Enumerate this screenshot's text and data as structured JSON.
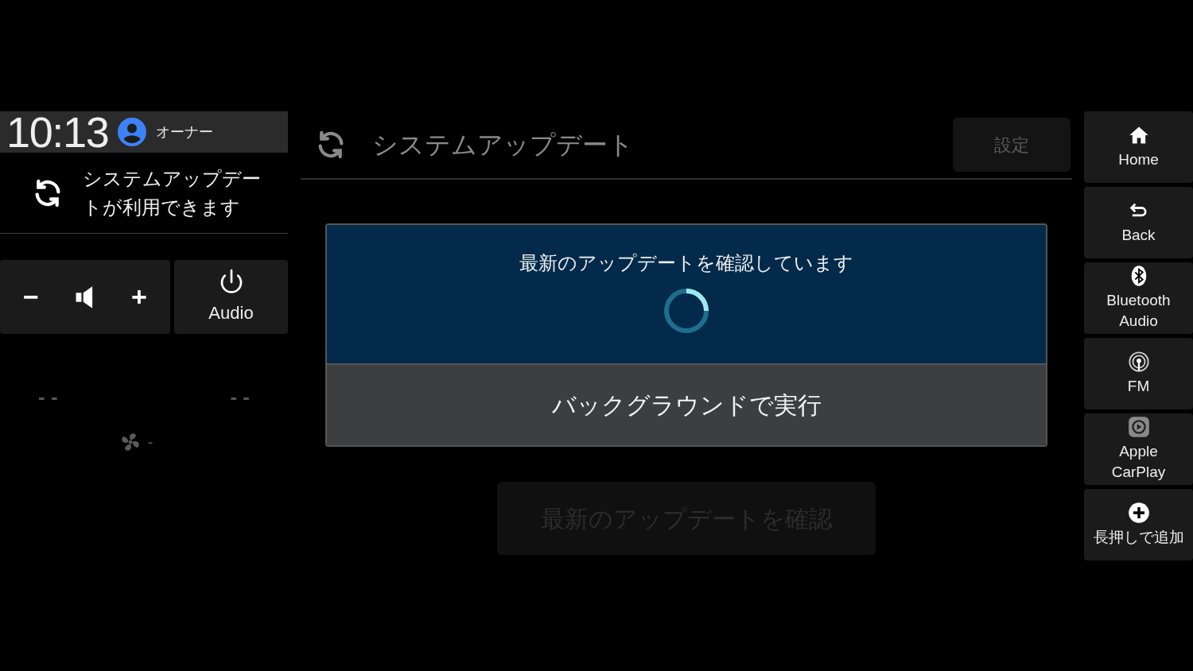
{
  "status": {
    "time": "10:13",
    "user": "オーナー"
  },
  "notification": {
    "text": "システムアップデートが利用できます"
  },
  "volume": {
    "minus": "−",
    "plus": "+"
  },
  "audio_button": {
    "label": "Audio"
  },
  "climate": {
    "left_temp": "- -",
    "right_temp": "- -",
    "fan_speed": "-"
  },
  "header": {
    "title": "システムアップデート",
    "settings_button": {
      "label": "設定",
      "disabled": true
    }
  },
  "dialog": {
    "message": "最新のアップデートを確認しています",
    "action": "バックグラウンドで実行"
  },
  "check_button": {
    "label": "最新のアップデートを確認",
    "disabled": true
  },
  "dock": [
    {
      "kind": "home",
      "label": "Home"
    },
    {
      "kind": "back",
      "label": "Back"
    },
    {
      "kind": "bluetooth",
      "label": "Bluetooth Audio"
    },
    {
      "kind": "fm",
      "label": "FM"
    },
    {
      "kind": "carplay",
      "label": "Apple CarPlay"
    },
    {
      "kind": "add",
      "label": "長押しで追加"
    }
  ]
}
